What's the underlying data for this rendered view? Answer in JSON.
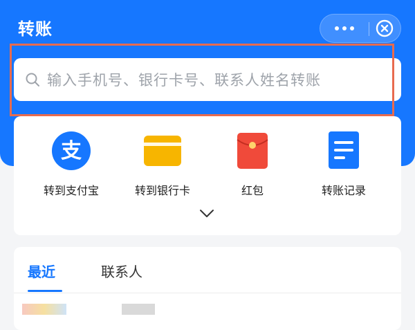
{
  "header": {
    "title": "转账",
    "more_icon": "more-dots-icon",
    "close_icon": "close-circle-icon"
  },
  "search": {
    "placeholder": "输入手机号、银行卡号、联系人姓名转账",
    "icon": "search-icon"
  },
  "shortcuts": [
    {
      "label": "转到支付宝",
      "icon": "alipay-icon"
    },
    {
      "label": "转到银行卡",
      "icon": "bank-card-icon"
    },
    {
      "label": "红包",
      "icon": "red-packet-icon"
    },
    {
      "label": "转账记录",
      "icon": "record-document-icon"
    }
  ],
  "expand_icon": "chevron-down-icon",
  "tabs": [
    {
      "label": "最近",
      "active": true
    },
    {
      "label": "联系人",
      "active": false
    }
  ],
  "colors": {
    "primary": "#1677ff",
    "highlight_border": "#e86b4e",
    "red_packet": "#f04a3a",
    "bank_card": "#f7b500"
  }
}
